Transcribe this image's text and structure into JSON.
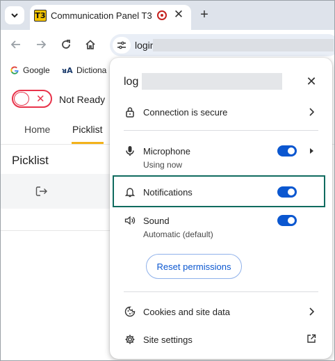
{
  "browser": {
    "tab": {
      "favicon_text": "T3",
      "title": "Communication Panel T3",
      "close_glyph": "✕"
    },
    "new_tab_glyph": "+",
    "omnibox": {
      "url_visible": "login"
    },
    "bookmarks": [
      {
        "label": "Google",
        "icon": "google-icon"
      },
      {
        "label": "Dictiona",
        "icon": "dictionary-icon"
      }
    ]
  },
  "page": {
    "status": {
      "label": "Not Ready",
      "x_glyph": "✕",
      "color": "#e8334a"
    },
    "nav_tabs": [
      {
        "label": "Home",
        "active": false
      },
      {
        "label": "Picklist",
        "active": true
      }
    ],
    "section_title": "Picklist",
    "accent": "#f3b21b"
  },
  "popup": {
    "host_visible": "log",
    "close_glyph": "✕",
    "connection": {
      "label": "Connection is secure",
      "icon": "lock-icon"
    },
    "permissions": [
      {
        "label": "Microphone",
        "sub": "Using now",
        "icon": "microphone-icon",
        "enabled": true
      },
      {
        "label": "Notifications",
        "sub": "",
        "icon": "bell-icon",
        "enabled": true,
        "highlighted": true
      },
      {
        "label": "Sound",
        "sub": "Automatic (default)",
        "icon": "speaker-icon",
        "enabled": true
      }
    ],
    "reset_button": "Reset permissions",
    "cookies": {
      "label": "Cookies and site data",
      "icon": "cookie-icon"
    },
    "site_settings": {
      "label": "Site settings",
      "icon": "gear-icon"
    },
    "switch_color": "#0b57d0",
    "highlight_color": "#0f6b5f"
  }
}
